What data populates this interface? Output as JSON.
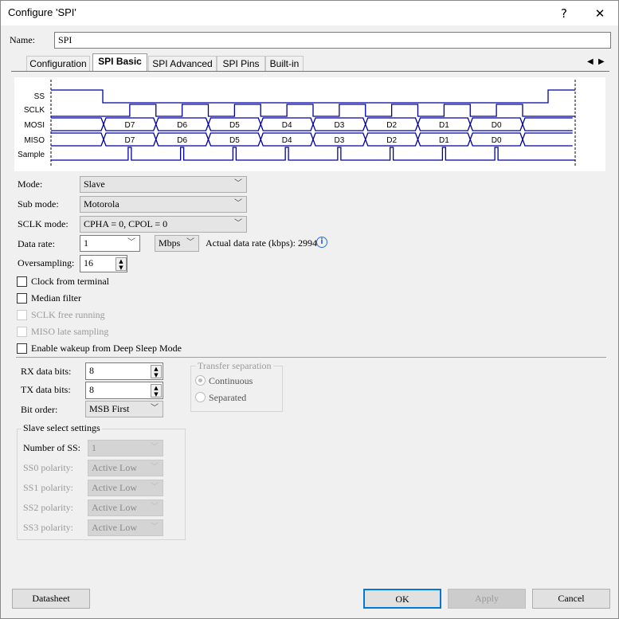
{
  "window": {
    "title": "Configure 'SPI'",
    "help": "?",
    "close": "✕"
  },
  "name": {
    "label": "Name:",
    "value": "SPI"
  },
  "tabs": [
    {
      "label": "Configuration"
    },
    {
      "label": "SPI Basic"
    },
    {
      "label": "SPI Advanced"
    },
    {
      "label": "SPI Pins"
    },
    {
      "label": "Built-in"
    }
  ],
  "tab_scroll": {
    "left": "◀",
    "right": "▶"
  },
  "waveform": {
    "signals": [
      "SS",
      "SCLK",
      "MOSI",
      "MISO",
      "Sample"
    ],
    "bits": [
      "D7",
      "D6",
      "D5",
      "D4",
      "D3",
      "D2",
      "D1",
      "D0"
    ],
    "color": "#0000a0"
  },
  "mode": {
    "label": "Mode:",
    "value": "Slave"
  },
  "sub_mode": {
    "label": "Sub mode:",
    "value": "Motorola"
  },
  "sclk_mode": {
    "label": "SCLK mode:",
    "value": "CPHA = 0, CPOL = 0"
  },
  "data_rate": {
    "label": "Data rate:",
    "value": "1",
    "unit": "Mbps",
    "actual": "Actual data rate (kbps): 2994"
  },
  "oversampling": {
    "label": "Oversampling:",
    "value": "16"
  },
  "checks": [
    {
      "label": "Clock from terminal",
      "checked": false,
      "enabled": true
    },
    {
      "label": "Median filter",
      "checked": false,
      "enabled": true
    },
    {
      "label": "SCLK free running",
      "checked": false,
      "enabled": false
    },
    {
      "label": "MISO late sampling",
      "checked": false,
      "enabled": false
    },
    {
      "label": "Enable wakeup from Deep Sleep Mode",
      "checked": false,
      "enabled": true
    }
  ],
  "rx_bits": {
    "label": "RX data bits:",
    "value": "8"
  },
  "tx_bits": {
    "label": "TX data bits:",
    "value": "8"
  },
  "bit_order": {
    "label": "Bit order:",
    "value": "MSB First"
  },
  "transfer_sep": {
    "title": "Transfer separation",
    "options": [
      "Continuous",
      "Separated"
    ],
    "selected": "Continuous"
  },
  "slave_select": {
    "title": "Slave select settings",
    "num_label": "Number of SS:",
    "num_value": "1",
    "polarities": [
      {
        "label": "SS0 polarity:",
        "value": "Active Low"
      },
      {
        "label": "SS1 polarity:",
        "value": "Active Low"
      },
      {
        "label": "SS2 polarity:",
        "value": "Active Low"
      },
      {
        "label": "SS3 polarity:",
        "value": "Active Low"
      }
    ]
  },
  "buttons": {
    "datasheet": "Datasheet",
    "ok": "OK",
    "apply": "Apply",
    "cancel": "Cancel"
  }
}
